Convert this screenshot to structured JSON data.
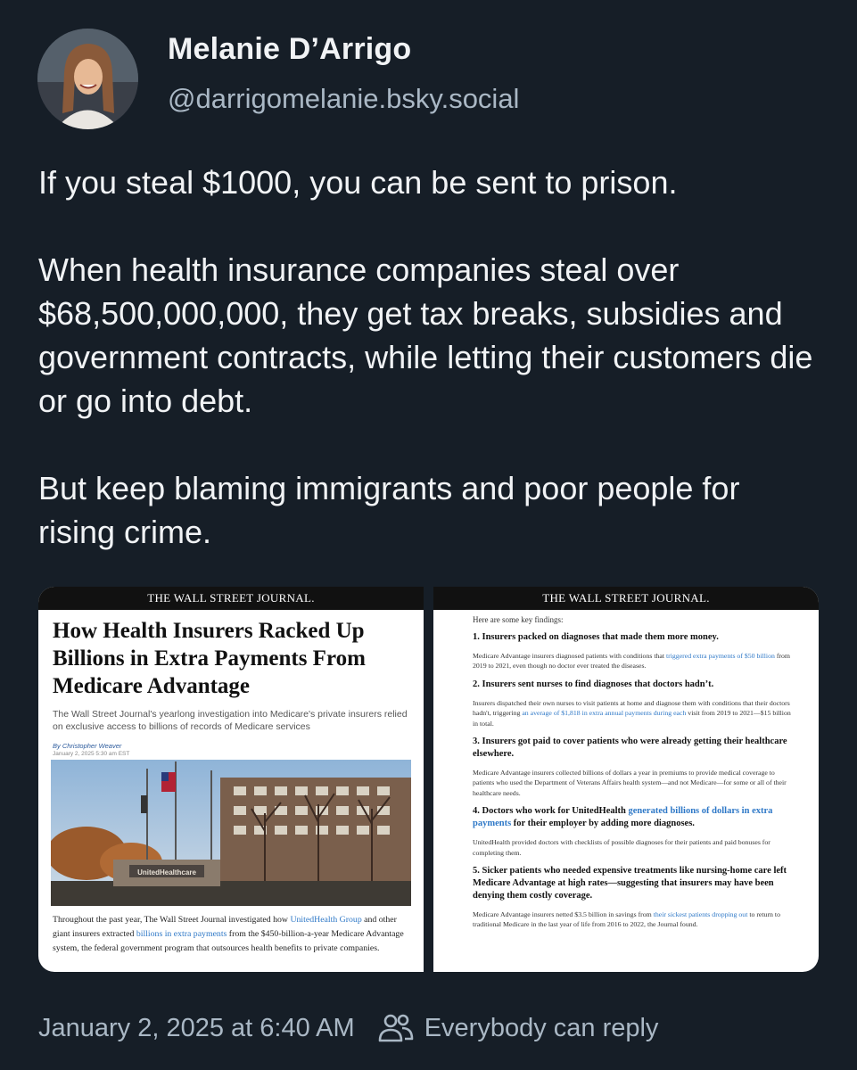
{
  "author": {
    "name": "Melanie D’Arrigo",
    "handle": "@darrigomelanie.bsky.social"
  },
  "post": {
    "paragraphs": [
      "If you steal $1000, you can be sent to prison.",
      "When health insurance companies steal over $68,500,000,000, they get tax breaks, subsidies and government contracts, while letting their customers die or go into debt.",
      "But keep blaming immigrants and poor people for rising crime."
    ]
  },
  "left_image": {
    "masthead": "THE WALL STREET JOURNAL.",
    "headline": "How Health Insurers Racked Up Billions in Extra Payments From Medicare Advantage",
    "dek": "The Wall Street Journal's yearlong investigation into Medicare's private insurers relied on exclusive access to billions of records of Medicare services",
    "byline": "By Christopher Weaver",
    "dateline": "January 2, 2025 5:30 am EST",
    "sign_text": "UnitedHealthcare",
    "caption_parts": [
      "Throughout the past year, The Wall Street Journal investigated how ",
      "UnitedHealth Group",
      " and other giant insurers extracted ",
      "billions in extra payments",
      " from the $450-billion-a-year Medicare Advantage system, the federal government program that outsources health benefits to private companies."
    ]
  },
  "right_image": {
    "masthead": "THE WALL STREET JOURNAL.",
    "intro": "Here are some key findings:",
    "findings": [
      {
        "title": "1. Insurers packed on diagnoses that made them more money.",
        "body": [
          "Medicare Advantage insurers diagnosed patients with conditions that ",
          "triggered extra payments of $50 billion",
          " from 2019 to 2021, even though no doctor ever treated the diseases."
        ]
      },
      {
        "title": "2. Insurers sent nurses to find diagnoses that doctors hadn’t.",
        "body": [
          "Insurers dispatched their own nurses to visit patients at home and diagnose them with conditions that their doctors hadn't, triggering ",
          "an average of $1,818 in extra annual payments during each",
          " visit from 2019 to 2021—$15 billion in total."
        ]
      },
      {
        "title": "3. Insurers got paid to cover patients who were already getting their healthcare elsewhere.",
        "body": [
          "Medicare Advantage insurers collected billions of dollars a year in premiums to provide medical coverage to patients who used the Department of Veterans Affairs health system—and not Medicare—for some or all of their healthcare needs.",
          "",
          ""
        ]
      },
      {
        "title_parts": [
          "4. Doctors who work for UnitedHealth ",
          "generated billions of dollars in extra payments",
          " for their employer by adding more diagnoses."
        ],
        "body": [
          "UnitedHealth provided doctors with checklists of possible diagnoses for their patients and paid bonuses for completing them.",
          "",
          ""
        ]
      },
      {
        "title": "5. Sicker patients who needed expensive treatments like nursing-home care left Medicare Advantage at high rates—suggesting that insurers may have been denying them costly coverage.",
        "body": [
          "Medicare Advantage insurers netted $3.5 billion in savings from ",
          "their sickest patients dropping out",
          " to return to traditional Medicare in the last year of life from 2016 to 2022, the Journal found."
        ]
      }
    ]
  },
  "footer": {
    "timestamp": "January 2, 2025 at 6:40 AM",
    "reply_setting": "Everybody can reply"
  },
  "colors": {
    "background": "#161e27",
    "text": "#f1f3f5",
    "muted": "#aab8c5",
    "link": "#2e78c7"
  }
}
